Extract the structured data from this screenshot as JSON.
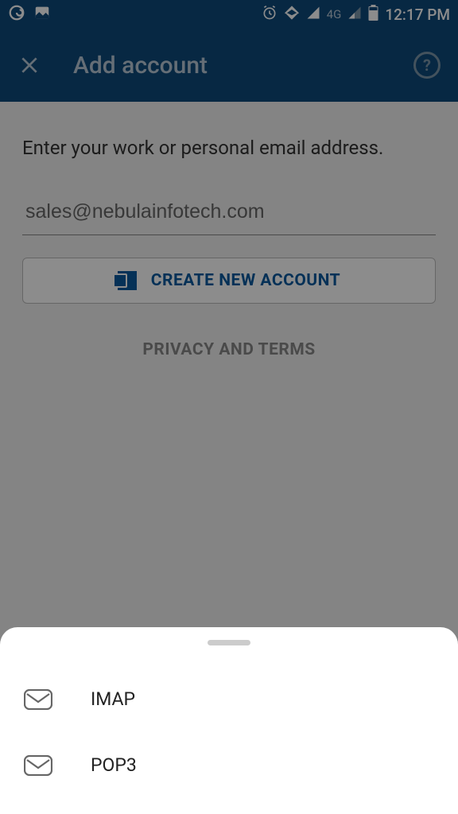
{
  "status": {
    "time": "12:17 PM",
    "network_label": "4G"
  },
  "appbar": {
    "title": "Add account"
  },
  "main": {
    "prompt": "Enter your work or personal email address.",
    "email_value": "sales@nebulainfotech.com",
    "create_label": "CREATE NEW ACCOUNT",
    "privacy_label": "PRIVACY AND TERMS"
  },
  "sheet": {
    "items": [
      {
        "label": "IMAP"
      },
      {
        "label": "POP3"
      }
    ]
  }
}
